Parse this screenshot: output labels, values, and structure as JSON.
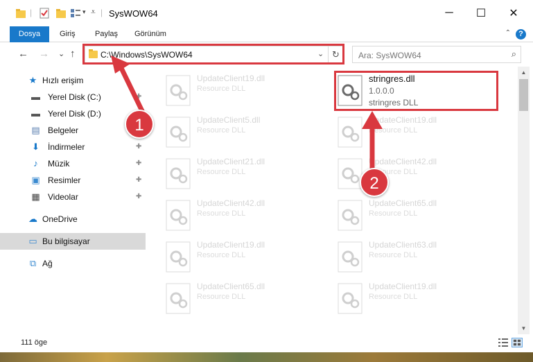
{
  "window": {
    "title": "SysWOW64",
    "minimize_glyph": "─",
    "maximize_glyph": "☐",
    "close_glyph": "✕"
  },
  "ribbon": {
    "tabs": [
      {
        "label": "Dosya"
      },
      {
        "label": "Giriş"
      },
      {
        "label": "Paylaş"
      },
      {
        "label": "Görünüm"
      }
    ],
    "help_glyph": "?",
    "collapse_glyph": "⌃"
  },
  "nav": {
    "back_glyph": "←",
    "forward_glyph": "→",
    "recent_glyph": "⌄",
    "up_glyph": "↑",
    "address_path": "C:\\Windows\\SysWOW64",
    "address_dropdown_glyph": "⌄",
    "refresh_glyph": "↻",
    "search_placeholder": "Ara: SysWOW64",
    "search_glyph": "⌕"
  },
  "sidebar": {
    "items": [
      {
        "label": "Hızlı erişim",
        "icon": "star-icon",
        "glyph": "★",
        "color": "#1979ca"
      },
      {
        "label": "Yerel Disk (C:)",
        "icon": "drive-icon",
        "glyph": "▬",
        "color": "#555555",
        "pinned": true
      },
      {
        "label": "Yerel Disk (D:)",
        "icon": "drive-icon",
        "glyph": "▬",
        "color": "#555555"
      },
      {
        "label": "Belgeler",
        "icon": "documents-icon",
        "glyph": "▤",
        "color": "#5a7fb0",
        "pinned": true
      },
      {
        "label": "İndirmeler",
        "icon": "download-icon",
        "glyph": "⬇",
        "color": "#1979ca",
        "pinned": true
      },
      {
        "label": "Müzik",
        "icon": "music-icon",
        "glyph": "♪",
        "color": "#1979ca",
        "pinned": true
      },
      {
        "label": "Resimler",
        "icon": "pictures-icon",
        "glyph": "▣",
        "color": "#3a8ad0",
        "pinned": true
      },
      {
        "label": "Videolar",
        "icon": "videos-icon",
        "glyph": "▦",
        "color": "#444444",
        "pinned": true
      },
      {
        "label": "OneDrive",
        "icon": "cloud-icon",
        "glyph": "☁",
        "color": "#1979ca"
      },
      {
        "label": "Bu bilgisayar",
        "icon": "computer-icon",
        "glyph": "▭",
        "color": "#3a8ad0"
      },
      {
        "label": "Ağ",
        "icon": "network-icon",
        "glyph": "⧉",
        "color": "#3a8ad0"
      }
    ],
    "pin_glyph": "✚"
  },
  "files": {
    "left_column": [
      {
        "name": "UpdateClient19.dll",
        "type": "Resource DLL"
      },
      {
        "name": "UpdateClient5.dll",
        "type": "Resource DLL"
      },
      {
        "name": "UpdateClient21.dll",
        "type": "Resource DLL"
      },
      {
        "name": "UpdateClient42.dll",
        "type": "Resource DLL"
      },
      {
        "name": "UpdateClient19.dll",
        "type": "Resource DLL"
      },
      {
        "name": "UpdateClient65.dll",
        "type": "Resource DLL"
      }
    ],
    "right_column": [
      {
        "name": "UpdateClient19.dll",
        "type": "Resource DLL"
      },
      {
        "name": "UpdateClient42.dll",
        "type": "Resource DLL"
      },
      {
        "name": "UpdateClient65.dll",
        "type": "Resource DLL"
      },
      {
        "name": "UpdateClient63.dll",
        "type": "Resource DLL"
      },
      {
        "name": "UpdateClient19.dll",
        "type": "Resource DLL"
      }
    ],
    "featured": {
      "name": "stringres.dll",
      "version": "1.0.0.0",
      "description": "stringres DLL"
    }
  },
  "status": {
    "item_count": "111 öge"
  },
  "annotations": {
    "badge_1": "1",
    "badge_2": "2",
    "color": "#d9383f"
  }
}
